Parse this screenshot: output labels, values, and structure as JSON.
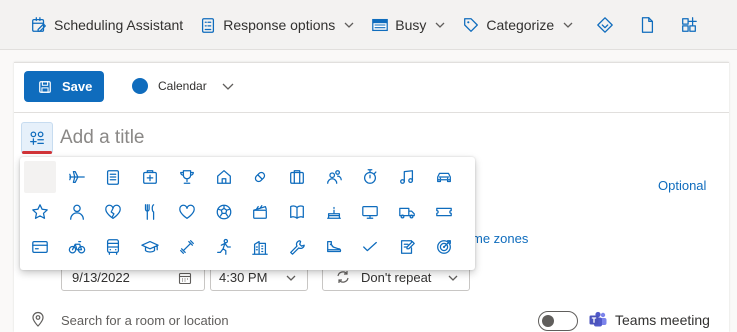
{
  "toolbar": {
    "scheduling_assistant": "Scheduling Assistant",
    "response_options": "Response options",
    "busy": "Busy",
    "categorize": "Categorize"
  },
  "form": {
    "save_label": "Save",
    "calendar_label": "Calendar",
    "title_placeholder": "Add a title",
    "optional_label": "Optional",
    "time_zones_label": "me zones",
    "date": "9/13/2022",
    "time": "4:30 PM",
    "repeat": "Don't repeat",
    "location_placeholder": "Search for a room or location",
    "teams_label": "Teams meeting"
  },
  "icon_picker": {
    "rows": [
      [
        "none",
        "airplane-icon",
        "clipboard-icon",
        "medical-kit-icon",
        "trophy-icon",
        "home-icon",
        "pill-icon",
        "briefcase-icon",
        "people-icon",
        "stopwatch-icon",
        "music-note-icon",
        "car-icon"
      ],
      [
        "star-icon",
        "person-icon",
        "broken-heart-icon",
        "utensils-icon",
        "heart-icon",
        "soccer-ball-icon",
        "clapperboard-icon",
        "book-icon",
        "cake-icon",
        "monitor-icon",
        "truck-icon",
        "ticket-icon"
      ],
      [
        "credit-card-icon",
        "bicycle-icon",
        "bus-icon",
        "graduation-cap-icon",
        "dumbbell-icon",
        "running-icon",
        "building-icon",
        "wrench-icon",
        "shoe-icon",
        "checkmark-icon",
        "notepad-icon",
        "target-icon"
      ]
    ]
  },
  "colors": {
    "accent": "#0f6cbd",
    "underline": "#d13438"
  }
}
